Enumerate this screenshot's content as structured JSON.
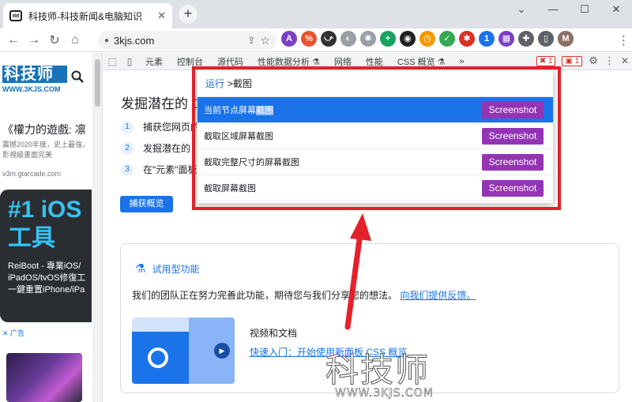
{
  "browser": {
    "tab_title": "科技师-科技新闻&电脑知识",
    "tab_favicon": "ಠಠ",
    "new_tab": "+",
    "url": "3kjs.com",
    "window_controls": [
      "⌄",
      "—",
      "☐"
    ]
  },
  "toolbar": {
    "back_icon": "←",
    "forward_icon": "→",
    "reload_icon": "↻",
    "home_icon": "⌂",
    "lock_icon": "🔒",
    "share_icon": "⇪",
    "star_icon": "☆",
    "extensions": [
      {
        "name": "a-ext-icon",
        "glyph": "A",
        "color": "#7b3fc6"
      },
      {
        "name": "percent-ext-icon",
        "glyph": "%",
        "color": "#e8532e"
      },
      {
        "name": "bird-ext-icon",
        "glyph": "⤻",
        "color": "#333333"
      },
      {
        "name": "gray-ext-icon",
        "glyph": "◐",
        "color": "#9aa0a6"
      },
      {
        "name": "wheel-ext-icon",
        "glyph": "✺",
        "color": "#9aa0a6"
      },
      {
        "name": "plus-ext-icon",
        "glyph": "+",
        "color": "#1aa260"
      },
      {
        "name": "face-ext-icon",
        "glyph": "◉",
        "color": "#202124"
      },
      {
        "name": "clock-ext-icon",
        "glyph": "◷",
        "color": "#f29900"
      },
      {
        "name": "check-ext-icon",
        "glyph": "✓",
        "color": "#34a853"
      },
      {
        "name": "bug-ext-icon",
        "glyph": "✱",
        "color": "#d93025"
      },
      {
        "name": "one-ext-icon",
        "glyph": "1",
        "color": "#1a73e8"
      },
      {
        "name": "grid-ext-icon",
        "glyph": "▦",
        "color": "#7b3fc6"
      },
      {
        "name": "puzzle-ext-icon",
        "glyph": "✚",
        "color": "#5f6368"
      },
      {
        "name": "sidebar-ext-icon",
        "glyph": "▯",
        "color": "#5f6368"
      },
      {
        "name": "avatar-ext-icon",
        "glyph": "M",
        "color": "#8d6e63"
      }
    ],
    "menu_icon": "⋮"
  },
  "left_page": {
    "logo_text": "科技师",
    "logo_sub": "WWW.3KJS.COM",
    "search_icon": "⚲",
    "news_title": "《權力的遊戲: 凛",
    "news_desc": "震撼2020年度，史上最強，影視級畫面完美",
    "news_source": "v3m.gtarcade.com",
    "ad_line1": "#1 iOS",
    "ad_line2": "工具",
    "ad_body": [
      "ReiBoot - 專業iOS/",
      "iPadOS/tvOS修復工",
      "一鍵重置iPhone/iPa"
    ],
    "ad_label": "✕ 广告"
  },
  "devtools": {
    "inspect_icon": "⬚",
    "device_icon": "▯",
    "tabs": [
      "元素",
      "控制台",
      "源代码",
      "性能数据分析 ⚗",
      "网络",
      "性能",
      "CSS 概览 ⚗"
    ],
    "more_tabs": "»",
    "error_count": "1",
    "warning_count": "1",
    "settings_icon": "⚙",
    "more_icon": "⋮",
    "panel_title": "发掘潜在的 C",
    "steps": [
      {
        "num": "1",
        "text": "捕获您网页的"
      },
      {
        "num": "2",
        "text": "发掘潜在的"
      },
      {
        "num": "3",
        "text": "在\"元素\"面板"
      }
    ],
    "capture_button": "捕获概览",
    "feature_title": "试用型功能",
    "feature_icon": "⚗",
    "feature_desc": "我们的团队正在努力完善此功能，期待您与我们分享您的想法。",
    "feature_link": "向我们提供反馈。",
    "video_label": "视频和文档",
    "video_link": "快速入门：开始使用新面板 CSS 概览",
    "play_icon": "▶"
  },
  "command_menu": {
    "prefix": "运行",
    "query": ">截图",
    "items": [
      {
        "label_pre": "当前节点屏幕",
        "label_hl": "截图",
        "label_post": "",
        "badge": "Screenshot",
        "selected": true
      },
      {
        "label_pre": "截取区域屏幕截图",
        "label_hl": "",
        "label_post": "",
        "badge": "Screenshot",
        "selected": false
      },
      {
        "label_pre": "截取完整尺寸的屏幕截图",
        "label_hl": "",
        "label_post": "",
        "badge": "Screenshot",
        "selected": false
      },
      {
        "label_pre": "截取屏幕截图",
        "label_hl": "",
        "label_post": "",
        "badge": "Screenshot",
        "selected": false
      }
    ]
  },
  "watermark": {
    "text": "科技师",
    "sub": "WWW.3KJS.COM"
  },
  "colors": {
    "accent": "#1a73e8",
    "annotation_red": "#e3212b",
    "screenshot_badge": "#9334b5"
  }
}
